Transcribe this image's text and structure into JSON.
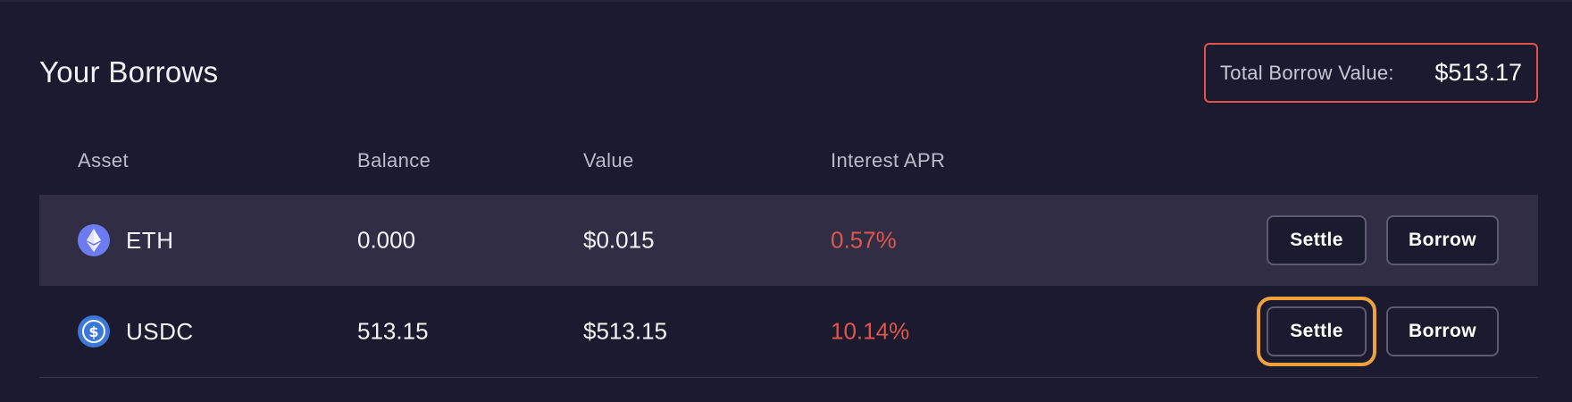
{
  "header": {
    "title": "Your Borrows",
    "total_label": "Total Borrow Value:",
    "total_value": "$513.17"
  },
  "table": {
    "columns": [
      "Asset",
      "Balance",
      "Value",
      "Interest APR"
    ],
    "rows": [
      {
        "asset": "ETH",
        "icon": "ethereum-icon",
        "balance": "0.000",
        "value": "$0.015",
        "apr": "0.57%",
        "settle_label": "Settle",
        "borrow_label": "Borrow"
      },
      {
        "asset": "USDC",
        "icon": "usdc-icon",
        "balance": "513.15",
        "value": "$513.15",
        "apr": "10.14%",
        "settle_label": "Settle",
        "borrow_label": "Borrow"
      }
    ]
  },
  "colors": {
    "background": "#1c1a2e",
    "row_highlight": "#302d45",
    "apr_red": "#e0564d",
    "total_border": "#e0524a",
    "focus_ring": "#f0a23a",
    "eth_icon": "#6c7cf0",
    "usdc_icon": "#3c78d8"
  }
}
